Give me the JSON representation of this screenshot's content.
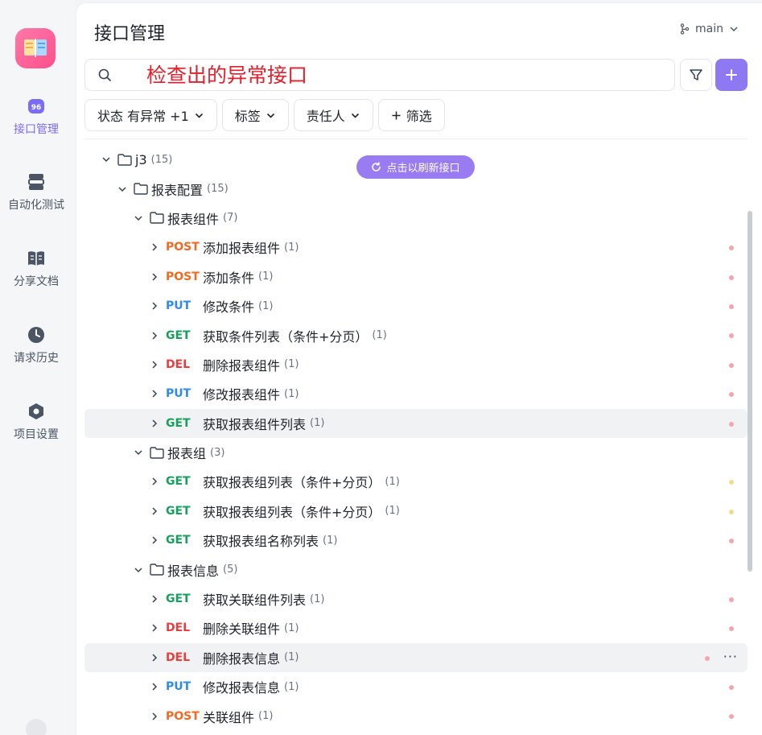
{
  "rail": {
    "items": [
      {
        "label": "接口管理",
        "icon": "api-management-icon",
        "active": true
      },
      {
        "label": "自动化测试",
        "icon": "automation-test-icon",
        "active": false
      },
      {
        "label": "分享文档",
        "icon": "share-docs-icon",
        "active": false
      },
      {
        "label": "请求历史",
        "icon": "history-clock-icon",
        "active": false
      },
      {
        "label": "项目设置",
        "icon": "project-settings-icon",
        "active": false
      }
    ]
  },
  "header": {
    "title": "接口管理",
    "branch": "main"
  },
  "search": {
    "value": "检查出的异常接口"
  },
  "chips": [
    {
      "label": "状态 有异常 +1",
      "icon": "chevron-down-icon"
    },
    {
      "label": "标签",
      "icon": "chevron-down-icon"
    },
    {
      "label": "责任人",
      "icon": "chevron-down-icon"
    },
    {
      "label": "筛选",
      "icon": "plus-icon"
    }
  ],
  "refresh_button": "点击以刷新接口",
  "colors": {
    "accent": "#8e79f3",
    "post": "#f06a21",
    "put": "#2e8be6",
    "get": "#17a05d",
    "del": "#eb3d3d",
    "search_text": "#e0202c"
  },
  "tree": [
    {
      "type": "folder",
      "level": 0,
      "name": "j3",
      "count": "(15)",
      "expanded": true
    },
    {
      "type": "folder",
      "level": 1,
      "name": "报表配置",
      "count": "(15)",
      "expanded": true
    },
    {
      "type": "folder",
      "level": 2,
      "name": "报表组件",
      "count": "(7)",
      "expanded": true
    },
    {
      "type": "api",
      "level": 3,
      "method": "POST",
      "name": "添加报表组件",
      "count": "(1)",
      "status": "red"
    },
    {
      "type": "api",
      "level": 3,
      "method": "POST",
      "name": "添加条件",
      "count": "(1)",
      "status": "red"
    },
    {
      "type": "api",
      "level": 3,
      "method": "PUT",
      "name": "修改条件",
      "count": "(1)",
      "status": "red"
    },
    {
      "type": "api",
      "level": 3,
      "method": "GET",
      "name": "获取条件列表（条件+分页）",
      "count": "(1)",
      "status": "red"
    },
    {
      "type": "api",
      "level": 3,
      "method": "DEL",
      "name": "删除报表组件",
      "count": "(1)",
      "status": "red"
    },
    {
      "type": "api",
      "level": 3,
      "method": "PUT",
      "name": "修改报表组件",
      "count": "(1)",
      "status": "red"
    },
    {
      "type": "api",
      "level": 3,
      "method": "GET",
      "name": "获取报表组件列表",
      "count": "(1)",
      "status": "red",
      "highlight": true
    },
    {
      "type": "folder",
      "level": 2,
      "name": "报表组",
      "count": "(3)",
      "expanded": true
    },
    {
      "type": "api",
      "level": 3,
      "method": "GET",
      "name": "获取报表组列表（条件+分页）",
      "count": "(1)",
      "status": "yellow"
    },
    {
      "type": "api",
      "level": 3,
      "method": "GET",
      "name": "获取报表组列表（条件+分页）",
      "count": "(1)",
      "status": "yellow"
    },
    {
      "type": "api",
      "level": 3,
      "method": "GET",
      "name": "获取报表组名称列表",
      "count": "(1)",
      "status": "red"
    },
    {
      "type": "folder",
      "level": 2,
      "name": "报表信息",
      "count": "(5)",
      "expanded": true
    },
    {
      "type": "api",
      "level": 3,
      "method": "GET",
      "name": "获取关联组件列表",
      "count": "(1)",
      "status": "red"
    },
    {
      "type": "api",
      "level": 3,
      "method": "DEL",
      "name": "删除关联组件",
      "count": "(1)",
      "status": "red"
    },
    {
      "type": "api",
      "level": 3,
      "method": "DEL",
      "name": "删除报表信息",
      "count": "(1)",
      "status": "red",
      "hover": true,
      "more": "···"
    },
    {
      "type": "api",
      "level": 3,
      "method": "PUT",
      "name": "修改报表信息",
      "count": "(1)",
      "status": "red"
    },
    {
      "type": "api",
      "level": 3,
      "method": "POST",
      "name": "关联组件",
      "count": "(1)",
      "status": "red"
    }
  ]
}
